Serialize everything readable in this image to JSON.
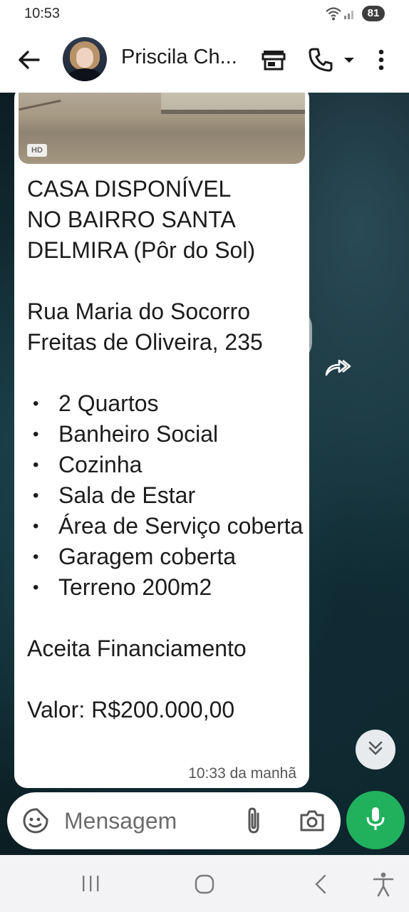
{
  "status_bar": {
    "time": "10:53",
    "battery": "81",
    "icons": [
      "wifi-icon",
      "signal-icon",
      "battery-icon"
    ]
  },
  "header": {
    "contact_name": "Priscila Ch...",
    "icons": [
      "back-arrow-icon",
      "avatar",
      "store-icon",
      "phone-icon",
      "chevron-down-icon",
      "more-vertical-icon"
    ]
  },
  "message": {
    "image_badge": "HD",
    "title_lines": [
      "CASA DISPONÍVEL",
      "NO BAIRRO SANTA",
      "DELMIRA (Pôr do Sol)"
    ],
    "address_lines": [
      "Rua Maria do Socorro",
      "Freitas de Oliveira, 235"
    ],
    "features": [
      "2 Quartos",
      "Banheiro Social",
      "Cozinha",
      "Sala de Estar",
      "Área de Serviço coberta",
      "Garagem coberta",
      "Terreno 200m2"
    ],
    "financing": "Aceita Financiamento",
    "price": "Valor: R$200.000,00",
    "timestamp": "10:33 da manhã"
  },
  "composer": {
    "placeholder": "Mensagem",
    "icons": [
      "sticker-icon",
      "attach-icon",
      "camera-icon",
      "mic-icon"
    ]
  },
  "colors": {
    "accent_green": "#21b15c",
    "bubble": "#ffffff",
    "chat_bg": "#163840"
  },
  "nav_bar": {
    "icons": [
      "recents-icon",
      "home-icon",
      "back-icon",
      "accessibility-icon"
    ]
  }
}
